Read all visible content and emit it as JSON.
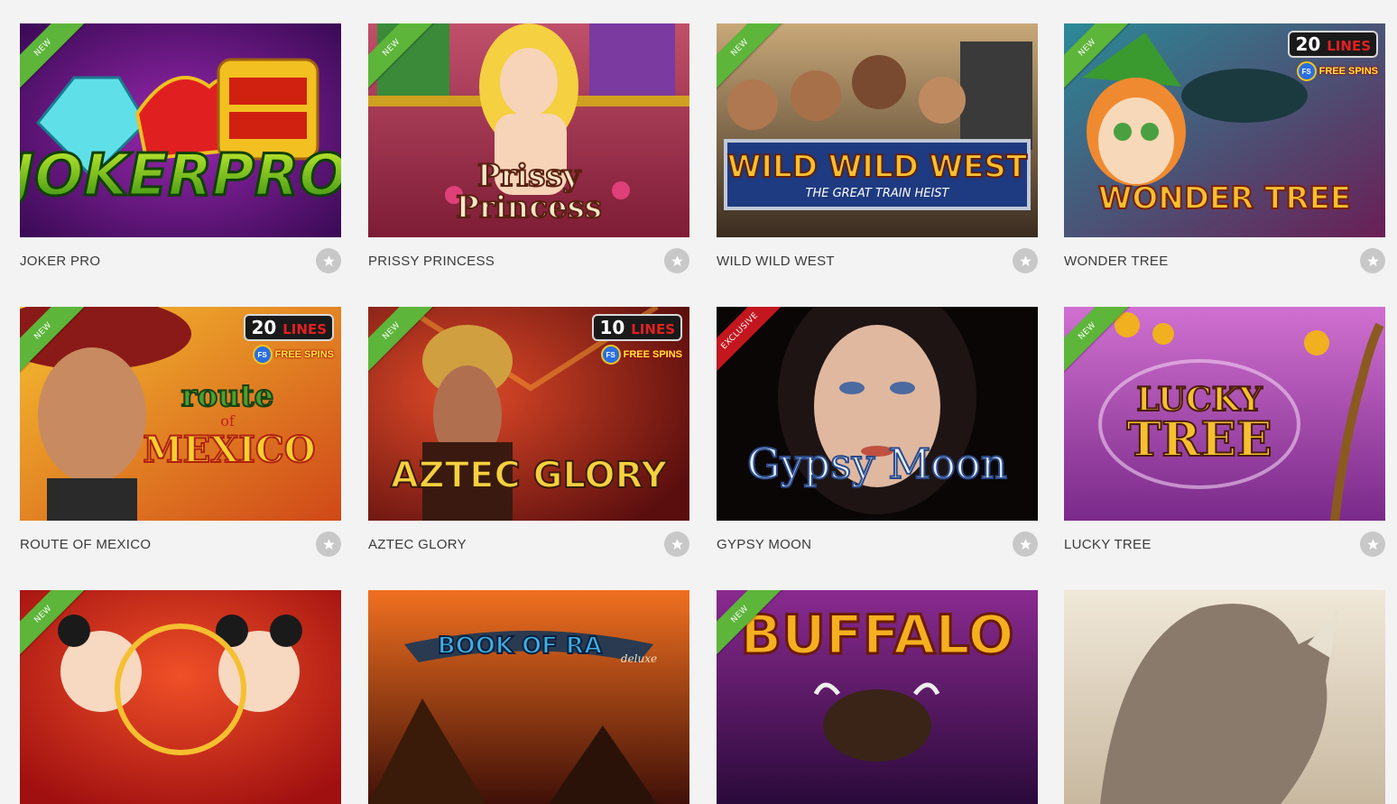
{
  "games": [
    {
      "title": "JOKER PRO",
      "badge": "NEW",
      "badge_color": "#5db53a",
      "art": "joker-pro-art",
      "logo": "JOKERPRO",
      "bg": [
        "#6a1580",
        "#3a0a55"
      ]
    },
    {
      "title": "PRISSY PRINCESS",
      "badge": "NEW",
      "badge_color": "#5db53a",
      "art": "prissy-princess-art",
      "logo": "Prissy Princess",
      "bg": [
        "#b0405a",
        "#7e1c36"
      ]
    },
    {
      "title": "WILD WILD WEST",
      "badge": "NEW",
      "badge_color": "#5db53a",
      "art": "wild-wild-west-art",
      "logo": "WILD WILD WEST",
      "sub": "THE GREAT TRAIN HEIST",
      "bg": [
        "#8a7050",
        "#3a2c20"
      ]
    },
    {
      "title": "WONDER TREE",
      "badge": "NEW",
      "badge_color": "#5db53a",
      "art": "wonder-tree-art",
      "logo": "WONDER TREE",
      "lines": "20",
      "lines_label": "LINES",
      "free_spins": "FREE SPINS",
      "bg": [
        "#1f6a78",
        "#5a1f46"
      ]
    },
    {
      "title": "ROUTE OF MEXICO",
      "badge": "NEW",
      "badge_color": "#5db53a",
      "art": "route-of-mexico-art",
      "logo": "route of MEXICO",
      "lines": "20",
      "lines_label": "LINES",
      "free_spins": "FREE SPINS",
      "bg": [
        "#f0a020",
        "#c0401a"
      ]
    },
    {
      "title": "AZTEC GLORY",
      "badge": "NEW",
      "badge_color": "#5db53a",
      "art": "aztec-glory-art",
      "logo": "AZTEC GLORY",
      "lines": "10",
      "lines_label": "LINES",
      "free_spins": "FREE SPINS",
      "bg": [
        "#b4301c",
        "#5a0e0e"
      ]
    },
    {
      "title": "GYPSY MOON",
      "badge": "EXCLUSIVE",
      "badge_color": "#c3161f",
      "art": "gypsy-moon-art",
      "logo": "Gypsy Moon",
      "bg": [
        "#2b1a1a",
        "#050505"
      ]
    },
    {
      "title": "LUCKY TREE",
      "badge": "NEW",
      "badge_color": "#5db53a",
      "art": "lucky-tree-art",
      "logo": "LUCKY TREE",
      "bg": [
        "#d65ab8",
        "#7a2a8a"
      ]
    },
    {
      "title": "",
      "badge": "NEW",
      "badge_color": "#5db53a",
      "art": "asian-children-art",
      "logo": "",
      "bg": [
        "#e0341a",
        "#a01010"
      ]
    },
    {
      "title": "",
      "badge": "",
      "badge_color": "",
      "art": "book-of-ra-art",
      "logo": "BOOK OF RA",
      "sub": "deluxe",
      "bg": [
        "#c0401a",
        "#401008"
      ]
    },
    {
      "title": "",
      "badge": "NEW",
      "badge_color": "#5db53a",
      "art": "buffalo-art",
      "logo": "BUFFALO",
      "bg": [
        "#6a1a70",
        "#2a0a3a"
      ]
    },
    {
      "title": "",
      "badge": "",
      "badge_color": "",
      "art": "rhino-art",
      "logo": "",
      "bg": [
        "#e8dcc8",
        "#9a8a78"
      ]
    }
  ],
  "favorite_icon": "star-icon"
}
